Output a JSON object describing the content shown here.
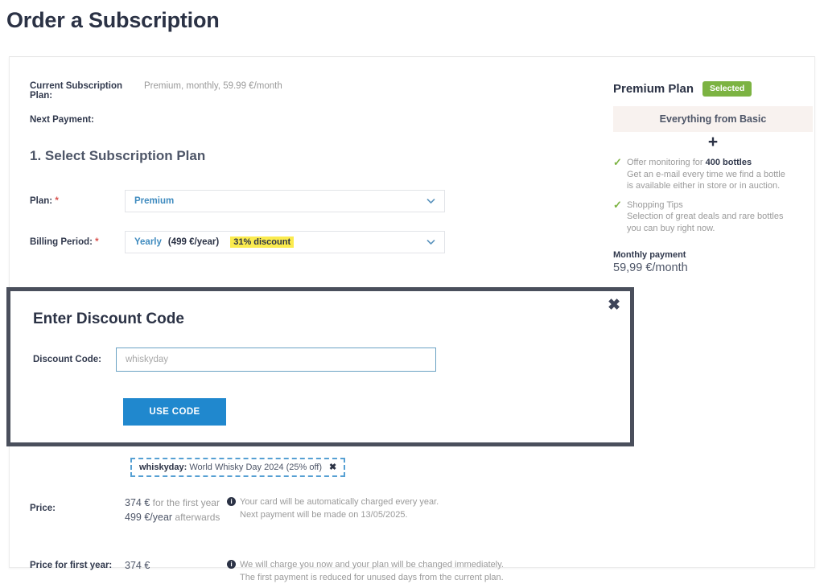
{
  "page": {
    "title": "Order a Subscription"
  },
  "summary": {
    "current_plan_label": "Current Subscription Plan:",
    "current_plan_value": "Premium, monthly, 59.99 €/month",
    "next_payment_label": "Next Payment:",
    "next_payment_value": ""
  },
  "section": {
    "heading": "1. Select Subscription Plan"
  },
  "form": {
    "plan": {
      "label": "Plan:",
      "required_mark": "*",
      "value": "Premium",
      "chevron_icon": "chevron-down-icon"
    },
    "billing": {
      "label": "Billing Period:",
      "required_mark": "*",
      "value": "Yearly",
      "extra": "(499 €/year)",
      "discount_badge": "31% discount",
      "chevron_icon": "chevron-down-icon"
    },
    "discount_link": "Enter Discount Code"
  },
  "plan_panel": {
    "title": "Premium Plan",
    "selected_badge": "Selected",
    "basic_banner": "Everything from Basic",
    "plus": "+",
    "features": [
      {
        "check_icon": "check-icon",
        "title_prefix": "Offer monitoring for ",
        "title_bold": "400 bottles",
        "desc_line1": "Get an e-mail every time we find a bottle",
        "desc_line2": "is available either in store or in auction."
      },
      {
        "check_icon": "check-icon",
        "title_prefix": "Shopping Tips",
        "title_bold": "",
        "desc_line1": "Selection of great deals and rare bottles",
        "desc_line2": "you can buy right now."
      }
    ],
    "payment_label": "Monthly payment",
    "payment_amount": "59,99 €/month"
  },
  "coupon": {
    "code": "whiskyday:",
    "description": "World Whisky Day 2024 (25% off)",
    "remove_icon": "close-icon"
  },
  "pricing": {
    "price_label": "Price:",
    "price_first_year": "374 €",
    "price_first_year_suffix": " for the first year",
    "price_afterwards": "499 €/year",
    "price_afterwards_suffix": " afterwards",
    "note1_line1": "Your card will be automatically charged every year.",
    "note1_line2": "Next payment will be made on 13/05/2025.",
    "first_year_label": "Price for first year:",
    "first_year_value": "374 €",
    "note2_line1": "We will charge you now and your plan will be changed immediately.",
    "note2_line2": "The first payment is reduced for unused days from the current plan.",
    "info_icon": "info-icon"
  },
  "modal": {
    "title": "Enter Discount Code",
    "close_icon": "close-icon",
    "field_label": "Discount Code:",
    "input_value": "",
    "input_placeholder": "whiskyday",
    "submit_label": "USE CODE"
  },
  "colors": {
    "accent_blue": "#2088ce",
    "link_blue": "#4a7fa5",
    "green": "#7cb342",
    "yellow": "#fbeb4e",
    "annotation_red": "#e11b22",
    "modal_border": "#4a4f5c",
    "text_dark": "#2b3245",
    "text_muted": "#9a9a9a"
  }
}
